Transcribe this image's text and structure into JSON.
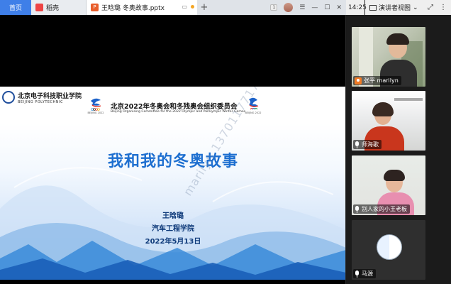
{
  "browser": {
    "tabs": [
      {
        "label": "首页",
        "active": false
      },
      {
        "label": "稻壳",
        "active": false
      },
      {
        "label": "王晗璐 冬奥故事.pptx",
        "active": true
      }
    ],
    "new_tab_symbol": "+",
    "badge": "1"
  },
  "slide": {
    "school_name": "北京电子科技职业学院",
    "school_name_en": "BEIJING POLYTECHNIC",
    "committee_cn": "北京2022年冬奥会和冬残奥会组织委员会",
    "committee_en": "Beijing Organising Committee for the 2022 Olympic and Paralympic Winter Games",
    "emblem_caption_1": "BEIJING 2022",
    "emblem_caption_2": "BEIJING 2022",
    "title": "我和我的冬奥故事",
    "author": "王晗璐",
    "college": "汽车工程学院",
    "date": "2022年5月13日",
    "watermark": "marilyn 13701177178"
  },
  "meeting": {
    "time": "14:25",
    "mode_label": "演讲者视图",
    "participants": [
      {
        "name": "张平 marilyn",
        "role": "host"
      },
      {
        "name": "师海歌",
        "role": "member"
      },
      {
        "name": "别人家的小王老板",
        "role": "member"
      },
      {
        "name": "马源",
        "role": "member"
      }
    ]
  },
  "colors": {
    "accent": "#3f7fe8",
    "title_blue": "#1e6fd0",
    "host_orange": "#f07b24"
  }
}
